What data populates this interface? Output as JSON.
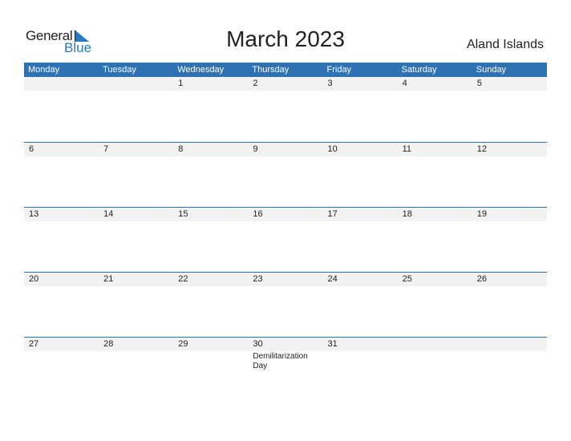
{
  "logo": {
    "word1": "General",
    "word2": "Blue"
  },
  "title": "March 2023",
  "country": "Aland Islands",
  "colors": {
    "accent": "#2e72b3",
    "strip": "#f2f2f2"
  },
  "weekdays": [
    "Monday",
    "Tuesday",
    "Wednesday",
    "Thursday",
    "Friday",
    "Saturday",
    "Sunday"
  ],
  "weeks": [
    {
      "days": [
        "",
        "",
        "1",
        "2",
        "3",
        "4",
        "5"
      ],
      "holidays": [
        "",
        "",
        "",
        "",
        "",
        "",
        ""
      ]
    },
    {
      "days": [
        "6",
        "7",
        "8",
        "9",
        "10",
        "11",
        "12"
      ],
      "holidays": [
        "",
        "",
        "",
        "",
        "",
        "",
        ""
      ]
    },
    {
      "days": [
        "13",
        "14",
        "15",
        "16",
        "17",
        "18",
        "19"
      ],
      "holidays": [
        "",
        "",
        "",
        "",
        "",
        "",
        ""
      ]
    },
    {
      "days": [
        "20",
        "21",
        "22",
        "23",
        "24",
        "25",
        "26"
      ],
      "holidays": [
        "",
        "",
        "",
        "",
        "",
        "",
        ""
      ]
    },
    {
      "days": [
        "27",
        "28",
        "29",
        "30",
        "31",
        "",
        ""
      ],
      "holidays": [
        "",
        "",
        "",
        "Demilitarization Day",
        "",
        "",
        ""
      ]
    }
  ]
}
